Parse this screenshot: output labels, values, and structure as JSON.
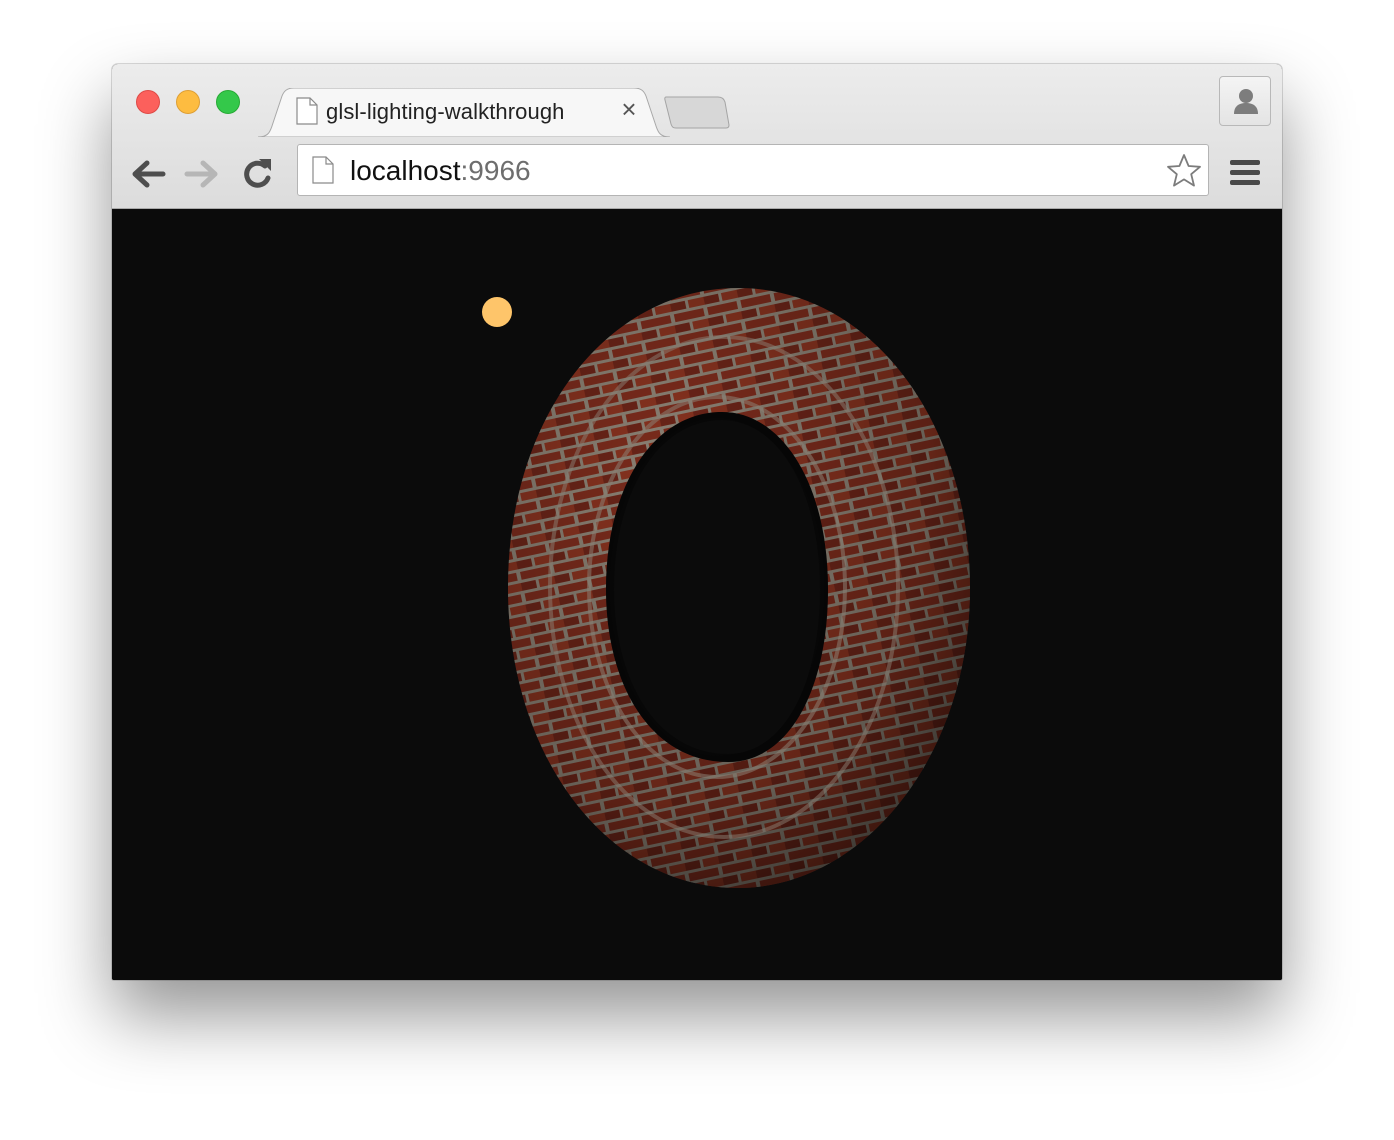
{
  "window": {
    "traffic_lights": {
      "close": "#fc605c",
      "minimize": "#fdbc40",
      "maximize": "#34c84a"
    }
  },
  "tab": {
    "title": "glsl-lighting-walkthrough",
    "favicon": "page-icon",
    "close_glyph": "×"
  },
  "toolbar": {
    "url_host": "localhost",
    "url_port": ":9966",
    "icons": [
      "back-arrow-icon",
      "forward-arrow-icon",
      "reload-icon",
      "page-icon",
      "bookmark-star-icon",
      "menu-icon",
      "profile-icon"
    ]
  },
  "scene": {
    "background": "#0b0b0b",
    "light_color": "#fec56a",
    "object": "brick-textured torus",
    "brick_color": "#7a2b1c",
    "mortar_color": "#8a8073"
  }
}
